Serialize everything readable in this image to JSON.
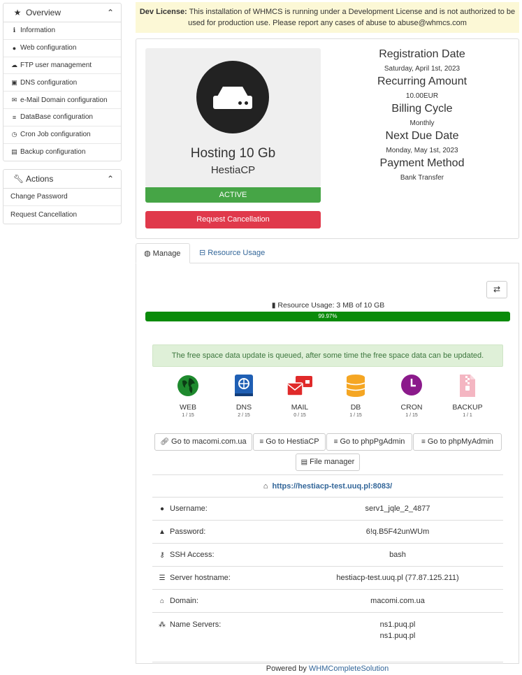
{
  "sidebar": {
    "overview": {
      "title": "Overview",
      "items": [
        {
          "label": "Information",
          "icon": "info-icon"
        },
        {
          "label": "Web configuration",
          "icon": "globe-icon"
        },
        {
          "label": "FTP user management",
          "icon": "cloud-icon"
        },
        {
          "label": "DNS configuration",
          "icon": "dns-book-icon"
        },
        {
          "label": "e-Mail Domain configuration",
          "icon": "mail-icon"
        },
        {
          "label": "DataBase configuration",
          "icon": "database-icon"
        },
        {
          "label": "Cron Job configuration",
          "icon": "clock-icon"
        },
        {
          "label": "Backup configuration",
          "icon": "file-archive-icon"
        }
      ]
    },
    "actions": {
      "title": "Actions",
      "items": [
        {
          "label": "Change Password"
        },
        {
          "label": "Request Cancellation"
        }
      ]
    }
  },
  "banner": {
    "strong": "Dev License:",
    "text": " This installation of WHMCS is running under a Development License and is not authorized to be used for production use. Please report any cases of abuse to abuse@whmcs.com"
  },
  "product": {
    "name": "Hosting 10 Gb",
    "module": "HestiaCP",
    "status": "ACTIVE",
    "cancel_label": "Request Cancellation"
  },
  "details": [
    {
      "label": "Registration Date",
      "value": "Saturday, April 1st, 2023"
    },
    {
      "label": "Recurring Amount",
      "value": "10.00EUR"
    },
    {
      "label": "Billing Cycle",
      "value": "Monthly"
    },
    {
      "label": "Next Due Date",
      "value": "Monday, May 1st, 2023"
    },
    {
      "label": "Payment Method",
      "value": "Bank Transfer"
    }
  ],
  "tabs": {
    "manage": "Manage",
    "resource": "Resource Usage"
  },
  "manage": {
    "resource_label": "Resource Usage:  3 MB of 10 GB",
    "progress_percent": 99.97,
    "progress_text": "99.97%",
    "alert": "The free space data update is queued, after some time the free space data can be updated.",
    "services": [
      {
        "name": "WEB",
        "count": "1 / 15",
        "color": "#1e8a2e"
      },
      {
        "name": "DNS",
        "count": "2 / 15",
        "color": "#1f5fb4"
      },
      {
        "name": "MAIL",
        "count": "0 / 15",
        "color": "#e02a2a"
      },
      {
        "name": "DB",
        "count": "1 / 15",
        "color": "#f5a623"
      },
      {
        "name": "CRON",
        "count": "1 / 15",
        "color": "#8b1a8b"
      },
      {
        "name": "BACKUP",
        "count": "1 / 1",
        "color": "#f4b6c2"
      }
    ],
    "buttons": {
      "site": "Go to macomi.com.ua",
      "hestia": "Go to HestiaCP",
      "pgadmin": "Go to phpPgAdmin",
      "myadmin": "Go to phpMyAdmin",
      "files": "File manager"
    },
    "url": "https://hestiacp-test.uuq.pl:8083/",
    "rows": {
      "username": {
        "label": "Username:",
        "value": "serv1_jqle_2_4877"
      },
      "password": {
        "label": "Password:",
        "value": "6!q.B5F42unWUm"
      },
      "ssh": {
        "label": "SSH Access:",
        "value": "bash"
      },
      "hostname": {
        "label": "Server hostname:",
        "value": "hestiacp-test.uuq.pl (77.87.125.211)"
      },
      "domain": {
        "label": "Domain:",
        "value": "macomi.com.ua"
      },
      "nameservers": {
        "label": "Name Servers:",
        "ns1": "ns1.puq.pl",
        "ns2": "ns1.puq.pl"
      }
    }
  },
  "footer": {
    "prefix": "Powered by ",
    "link": "WHMCompleteSolution"
  }
}
